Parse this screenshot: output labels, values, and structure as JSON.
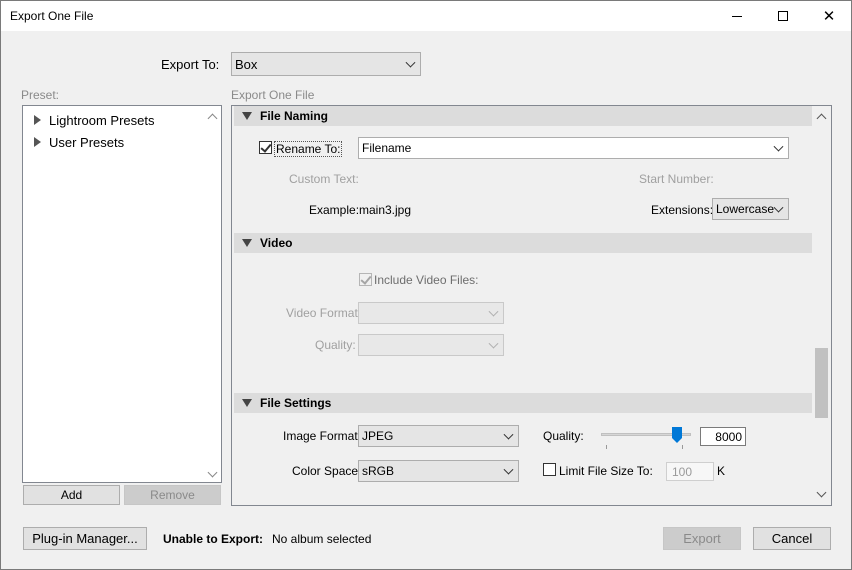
{
  "window": {
    "title": "Export One File",
    "minimize_glyph": "—",
    "maximize_glyph": "☐",
    "close_glyph": "✕"
  },
  "export_to": {
    "label": "Export To:",
    "value": "Box"
  },
  "preset": {
    "label": "Preset:",
    "items": [
      "Lightroom Presets",
      "User Presets"
    ],
    "add_label": "Add",
    "remove_label": "Remove"
  },
  "main": {
    "header": "Export One File",
    "file_naming": {
      "title": "File Naming",
      "rename_label": "Rename To:",
      "rename_checked": true,
      "rename_value": "Filename",
      "custom_text_label": "Custom Text:",
      "start_number_label": "Start Number:",
      "example_label": "Example:",
      "example_value": "main3.jpg",
      "extensions_label": "Extensions:",
      "extensions_value": "Lowercase"
    },
    "video": {
      "title": "Video",
      "include_label": "Include Video Files:",
      "include_checked": true,
      "video_format_label": "Video Format:",
      "quality_label": "Quality:"
    },
    "file_settings": {
      "title": "File Settings",
      "image_format_label": "Image Format:",
      "image_format_value": "JPEG",
      "quality_label": "Quality:",
      "quality_value": "8000",
      "quality_fraction": 0.82,
      "color_space_label": "Color Space:",
      "color_space_value": "sRGB",
      "limit_label": "Limit File Size To:",
      "limit_checked": false,
      "limit_value": "100",
      "limit_unit": "K"
    }
  },
  "footer": {
    "plugin_manager_label": "Plug-in Manager...",
    "unable_label": "Unable to Export:",
    "unable_reason": "No album selected",
    "export_label": "Export",
    "cancel_label": "Cancel"
  },
  "colors": {
    "accent": "#0078d7",
    "section_header_bg": "#dcdcdc",
    "scroll_thumb": "#c1c1c1"
  }
}
